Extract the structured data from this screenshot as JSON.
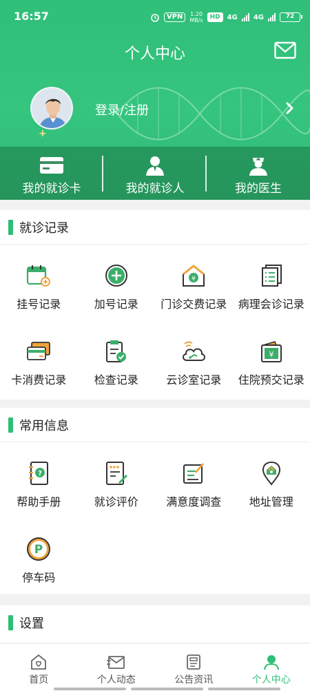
{
  "status": {
    "time": "16:57",
    "vpn": "VPN",
    "speed_top": "1.20",
    "speed_bottom": "MB/s",
    "hd": "HD",
    "net1": "4G",
    "net2": "4G",
    "battery": "72"
  },
  "header": {
    "title": "个人中心",
    "login_text": "登录/注册"
  },
  "quick": [
    {
      "label": "我的就诊卡",
      "icon": "card-icon"
    },
    {
      "label": "我的就诊人",
      "icon": "patient-icon"
    },
    {
      "label": "我的医生",
      "icon": "doctor-icon"
    }
  ],
  "sections": {
    "records": {
      "title": "就诊记录",
      "items": [
        {
          "label": "挂号记录",
          "icon": "calendar-plus-icon"
        },
        {
          "label": "加号记录",
          "icon": "plus-circle-icon"
        },
        {
          "label": "门诊交费记录",
          "icon": "house-coin-icon"
        },
        {
          "label": "病理会诊记录",
          "icon": "document-list-icon"
        },
        {
          "label": "卡消费记录",
          "icon": "cards-icon"
        },
        {
          "label": "检查记录",
          "icon": "clipboard-check-icon"
        },
        {
          "label": "云诊室记录",
          "icon": "cloud-icon"
        },
        {
          "label": "住院预交记录",
          "icon": "wallet-yen-icon"
        }
      ]
    },
    "common": {
      "title": "常用信息",
      "items": [
        {
          "label": "帮助手册",
          "icon": "help-book-icon"
        },
        {
          "label": "就诊评价",
          "icon": "review-icon"
        },
        {
          "label": "满意度调查",
          "icon": "survey-icon"
        },
        {
          "label": "地址管理",
          "icon": "location-icon"
        },
        {
          "label": "停车码",
          "icon": "parking-icon"
        }
      ]
    },
    "settings": {
      "title": "设置"
    }
  },
  "tabs": [
    {
      "label": "首页",
      "icon": "home-icon",
      "active": false
    },
    {
      "label": "个人动态",
      "icon": "news-icon",
      "active": false
    },
    {
      "label": "公告资讯",
      "icon": "notice-icon",
      "active": false
    },
    {
      "label": "个人中心",
      "icon": "user-icon",
      "active": true
    }
  ],
  "colors": {
    "primary": "#2dbf78",
    "header_start": "#2fbf7a",
    "icon_green": "#3cae6a",
    "icon_orange": "#f0a33c"
  }
}
